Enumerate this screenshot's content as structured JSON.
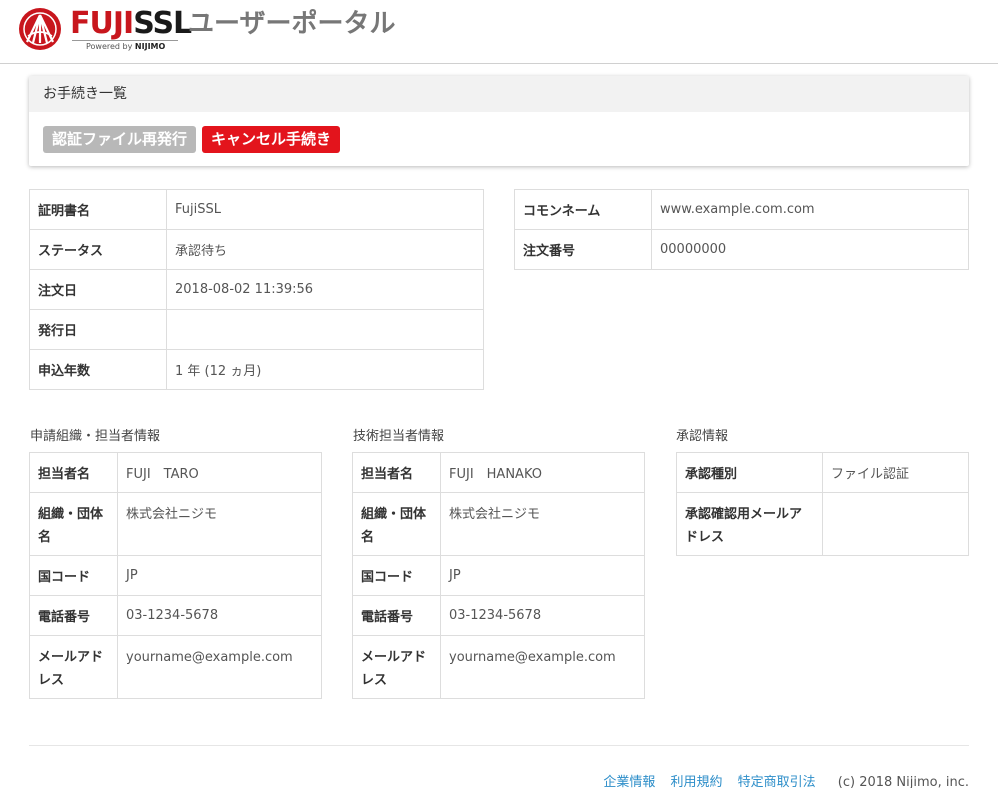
{
  "header": {
    "logo_fuji": "FUJI",
    "logo_ssl": "SSL",
    "logo_powered": "Powered by",
    "logo_nijimo": "NIJIMO",
    "portal_title": "ユーザーポータル"
  },
  "procedures": {
    "title": "お手続き一覧",
    "reissue_label": "認証ファイル再発行",
    "cancel_label": "キャンセル手続き"
  },
  "certificate": {
    "name_label": "証明書名",
    "name_value": "FujiSSL",
    "status_label": "ステータス",
    "status_value": "承認待ち",
    "order_date_label": "注文日",
    "order_date_value": "2018-08-02 11:39:56",
    "issue_date_label": "発行日",
    "issue_date_value": "",
    "years_label": "申込年数",
    "years_value": "1 年 (12 ヵ月)"
  },
  "common": {
    "cn_label": "コモンネーム",
    "cn_value": "www.example.com.com",
    "order_no_label": "注文番号",
    "order_no_value": "00000000"
  },
  "applicant": {
    "section_title": "申請組織・担当者情報",
    "person_label": "担当者名",
    "person_value": "FUJI　TARO",
    "org_label": "組織・団体名",
    "org_value": "株式会社ニジモ",
    "country_label": "国コード",
    "country_value": "JP",
    "phone_label": "電話番号",
    "phone_value": "03-1234-5678",
    "email_label": "メールアドレス",
    "email_value": "yourname@example.com"
  },
  "technical": {
    "section_title": "技術担当者情報",
    "person_label": "担当者名",
    "person_value": "FUJI　HANAKO",
    "org_label": "組織・団体名",
    "org_value": "株式会社ニジモ",
    "country_label": "国コード",
    "country_value": "JP",
    "phone_label": "電話番号",
    "phone_value": "03-1234-5678",
    "email_label": "メールアドレス",
    "email_value": "yourname@example.com"
  },
  "approval": {
    "section_title": "承認情報",
    "type_label": "承認種別",
    "type_value": "ファイル認証",
    "email_label": "承認確認用メールアドレス",
    "email_value": ""
  },
  "footer": {
    "link_company": "企業情報",
    "link_terms": "利用規約",
    "link_law": "特定商取引法",
    "copyright": "(c) 2018 Nijimo, inc."
  },
  "colors": {
    "brand_red": "#e3141c",
    "link_blue": "#2d8ec9",
    "disabled_gray": "#b8b8b8"
  }
}
